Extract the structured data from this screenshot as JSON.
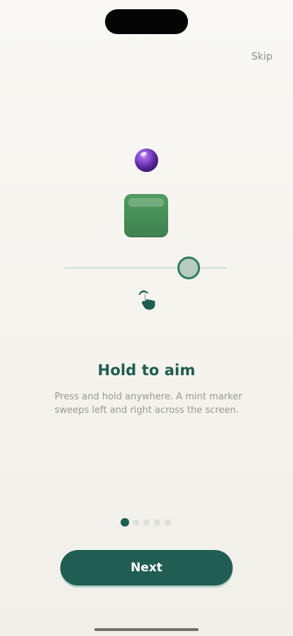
{
  "onboarding": {
    "skip_label": "Skip",
    "title": "Hold to aim",
    "description": "Press and hold anywhere. A mint marker sweeps left and right across the screen.",
    "next_label": "Next",
    "current_page": 1,
    "total_pages": 5,
    "aim_marker_position": 0.76
  },
  "icons": {
    "ball": "purple-ball-icon",
    "target_block": "green-block-icon",
    "gesture": "hand-tap-icon"
  },
  "colors": {
    "accent": "#205d52",
    "ball": "#7c43c4",
    "block": "#46905a",
    "marker_ring": "#2f7d63",
    "marker_fill": "#b8ccc0",
    "muted_text": "#999894",
    "inactive_dot": "#dfdfdb"
  }
}
